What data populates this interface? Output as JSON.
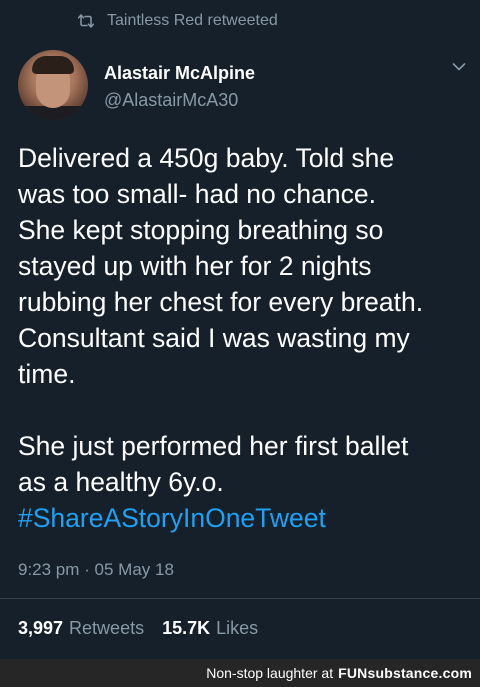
{
  "retweet": {
    "label": "Taintless Red retweeted"
  },
  "author": {
    "name": "Alastair McAlpine",
    "handle": "@AlastairMcA30"
  },
  "tweet": {
    "lines": [
      "Delivered a 450g baby. Told she",
      "was too small- had no chance.",
      "She kept stopping breathing so",
      "stayed up with her for 2 nights",
      "rubbing her chest for every breath.",
      "Consultant said I was wasting my",
      "time.",
      "She just performed her first ballet",
      "as a healthy 6y.o."
    ],
    "hashtag": "#ShareAStoryInOneTweet",
    "timestamp": "9:23 pm · 05 May 18"
  },
  "stats": {
    "retweets_count": "3,997",
    "retweets_label": "Retweets",
    "likes_count": "15.7K",
    "likes_label": "Likes"
  },
  "footer": {
    "tagline": "Non-stop laughter at",
    "brand": "FUNsubstance.com"
  },
  "colors": {
    "background": "#15202b",
    "accent": "#1da1f2",
    "muted": "#8899a6"
  },
  "icons": {
    "retweet": "retweet-icon",
    "menu": "chevron-down-icon"
  }
}
